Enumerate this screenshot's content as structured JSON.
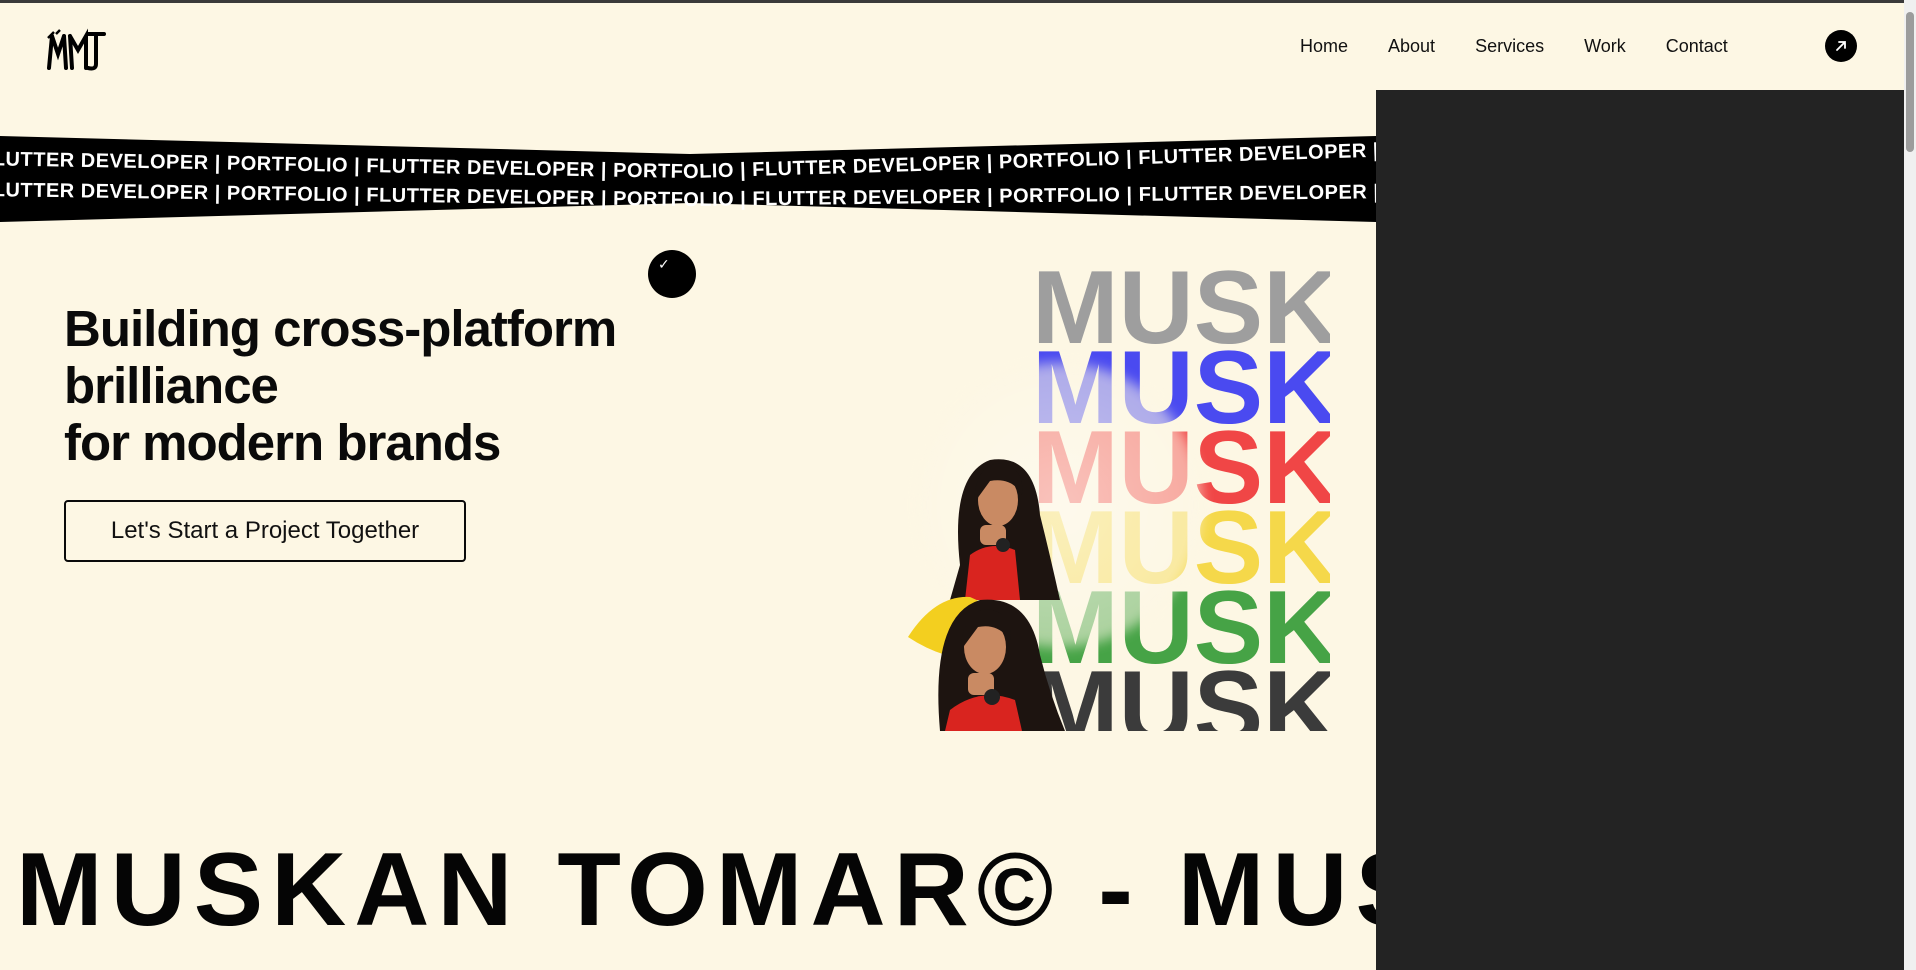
{
  "header": {
    "logo_label": "MT",
    "nav": [
      "Home",
      "About",
      "Services",
      "Work",
      "Contact"
    ],
    "cta_icon": "arrow-up-right-icon"
  },
  "ribbon": {
    "line1": "FLUTTER DEVELOPER | PORTFOLIO | FLUTTER DEVELOPER | PORTFOLIO | FLUTTER DEVELOPER | PORTFOLIO | FLUTTER DEVELOPER | PORTFOLIO | FLUTTER DEVELOPER | PORTFOLIO |",
    "line2": "FLUTTER DEVELOPER | PORTFOLIO | FLUTTER DEVELOPER | PORTFOLIO | FLUTTER DEVELOPER | PORTFOLIO | FLUTTER DEVELOPER | PORTFOLIO | FLUTTER DEVELOPER | PORTFOLIO |"
  },
  "hero": {
    "title_line1": "Building cross-platform",
    "title_line2": "brilliance",
    "title_line3": "for modern brands",
    "cta": "Let's Start a Project Together"
  },
  "art": {
    "name_word": "MUSKAN",
    "colors": [
      "#9e9e9e",
      "#4a4af0",
      "#f04646",
      "#f5d84a",
      "#46a346",
      "#3b3b3b"
    ]
  },
  "marquee": {
    "text": "MUSKAN TOMAR© -  MUSKAN TOMAR© -"
  },
  "theme": {
    "background": "#fdf7e4",
    "panel": "#232323",
    "ink": "#0a0a0a"
  }
}
